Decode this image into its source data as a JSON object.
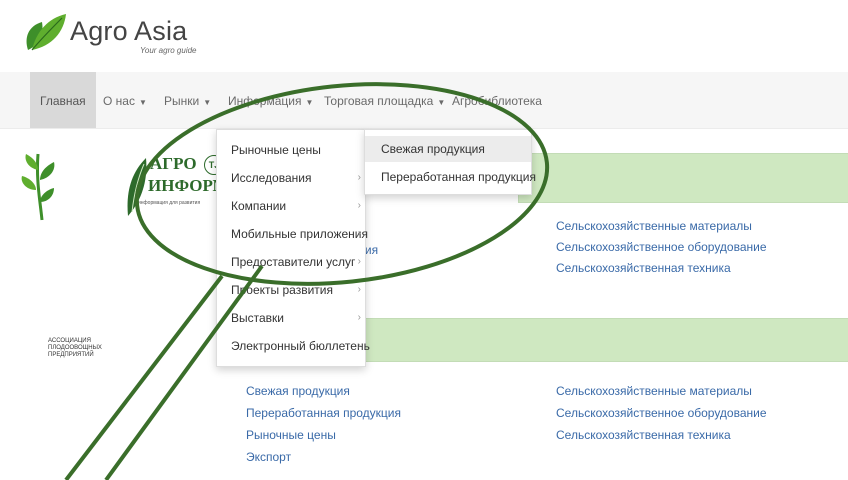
{
  "brand": {
    "name": "Agro Asia",
    "tagline": "Your agro guide"
  },
  "nav": {
    "home": "Главная",
    "about": "О нас",
    "markets": "Рынки",
    "info": "Информация",
    "trade": "Торговая площадка",
    "library": "Агробиблиотека"
  },
  "partners": {
    "association": "Ассоциация плодоовощных предприятий",
    "agro_top": "АГРО",
    "agro_bottom": "ИНФОРМ",
    "agro_badge": "TJ",
    "agro_sub": "информация для развития"
  },
  "dropdown": {
    "items": [
      "Рыночные цены",
      "Исследования",
      "Компании",
      "Мобильные приложения",
      "Предоставители услуг",
      "Проекты развития",
      "Выставки",
      "Электронный бюллетень"
    ],
    "arrow": "›"
  },
  "submenu": {
    "items": [
      "Свежая продукция",
      "Переработанная продукция"
    ]
  },
  "section1": {
    "partial_left": "ция",
    "right": [
      "Сельскохозяйственные материалы",
      "Сельскохозяйственное оборудование",
      "Сельскохозяйственная техника"
    ]
  },
  "section2": {
    "left": [
      "Свежая продукция",
      "Переработанная продукция",
      "Рыночные цены",
      "Экспорт"
    ],
    "right": [
      "Сельскохозяйственные материалы",
      "Сельскохозяйственное оборудование",
      "Сельскохозяйственная техника"
    ]
  },
  "colors": {
    "accent_green": "#3e7d2e",
    "link": "#3a6aa8",
    "bar": "#cfe8c1"
  }
}
